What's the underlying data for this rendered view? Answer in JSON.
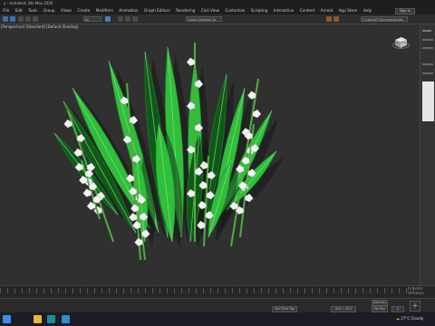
{
  "window": {
    "title": "y - Autodesk 3ds Max 2020"
  },
  "menu": [
    "File",
    "Edit",
    "Tools",
    "Group",
    "Views",
    "Create",
    "Modifiers",
    "Animation",
    "Graph Editors",
    "Rendering",
    "Civil View",
    "Customize",
    "Scripting",
    "Interactive",
    "Content",
    "Arnold",
    "App Store",
    "Help"
  ],
  "toolbar": {
    "selection_filter": "All",
    "named_selection": "Create Selection Se",
    "workspace_path": "C:\\Users\\PC\\Documents\\3ds Max 2020"
  },
  "signin": "Sign In",
  "viewport": {
    "label": "[Perspective] [Standard] [Default Shading]"
  },
  "timeline": {
    "frame_display": "0 / 100"
  },
  "status": {
    "add_time_tag": "Add Time Tag",
    "x": "",
    "y": "",
    "z": "",
    "grid": "Grid = 10.0",
    "auto_key": "Auto Key",
    "set_key": "Set Key",
    "frame_value": "0"
  },
  "activate_windows": "Activate Windows",
  "taskbar": {
    "weather": "27°C  Cloudy"
  },
  "colors": {
    "leaf": "#2fbf3b",
    "leaf_dark": "#0d5a17",
    "flower": "#f2f2f2",
    "accent": "#2e8bd6"
  }
}
